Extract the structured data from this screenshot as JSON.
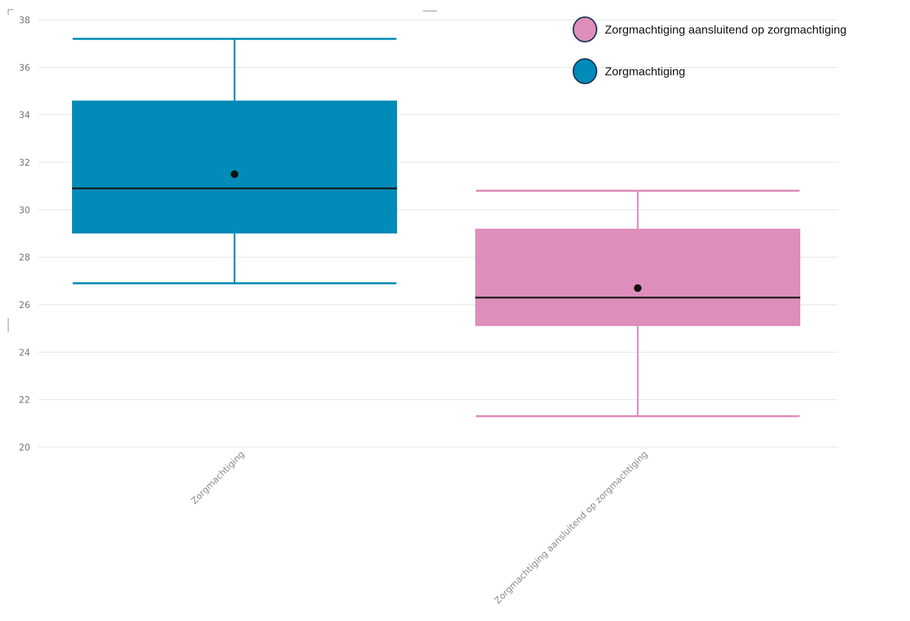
{
  "chart_data": {
    "type": "box",
    "y_ticks": [
      "20",
      "22",
      "24",
      "26",
      "28",
      "30",
      "32",
      "34",
      "36",
      "38"
    ],
    "ylim": [
      20,
      38
    ],
    "grid": true,
    "legend_placement": "top-right",
    "categories": [
      "Zorgmachtiging",
      "Zorgmachtiging aansluitend op zorgmachtiging"
    ],
    "series": [
      {
        "category": "Zorgmachtiging",
        "color": "#008BB8",
        "whisker_min": 26.9,
        "q1": 29.0,
        "median": 30.9,
        "mean": 31.5,
        "q3": 34.6,
        "whisker_max": 37.2
      },
      {
        "category": "Zorgmachtiging aansluitend op zorgmachtiging",
        "color": "#DE8EBB",
        "whisker_min": 21.3,
        "q1": 25.1,
        "median": 26.3,
        "mean": 26.7,
        "q3": 29.2,
        "whisker_max": 30.8
      }
    ],
    "legend": [
      {
        "label": "Zorgmachtiging aansluitend op zorgmachtiging",
        "color": "#DE8EBB"
      },
      {
        "label": "Zorgmachtiging",
        "color": "#008BB8"
      }
    ]
  }
}
